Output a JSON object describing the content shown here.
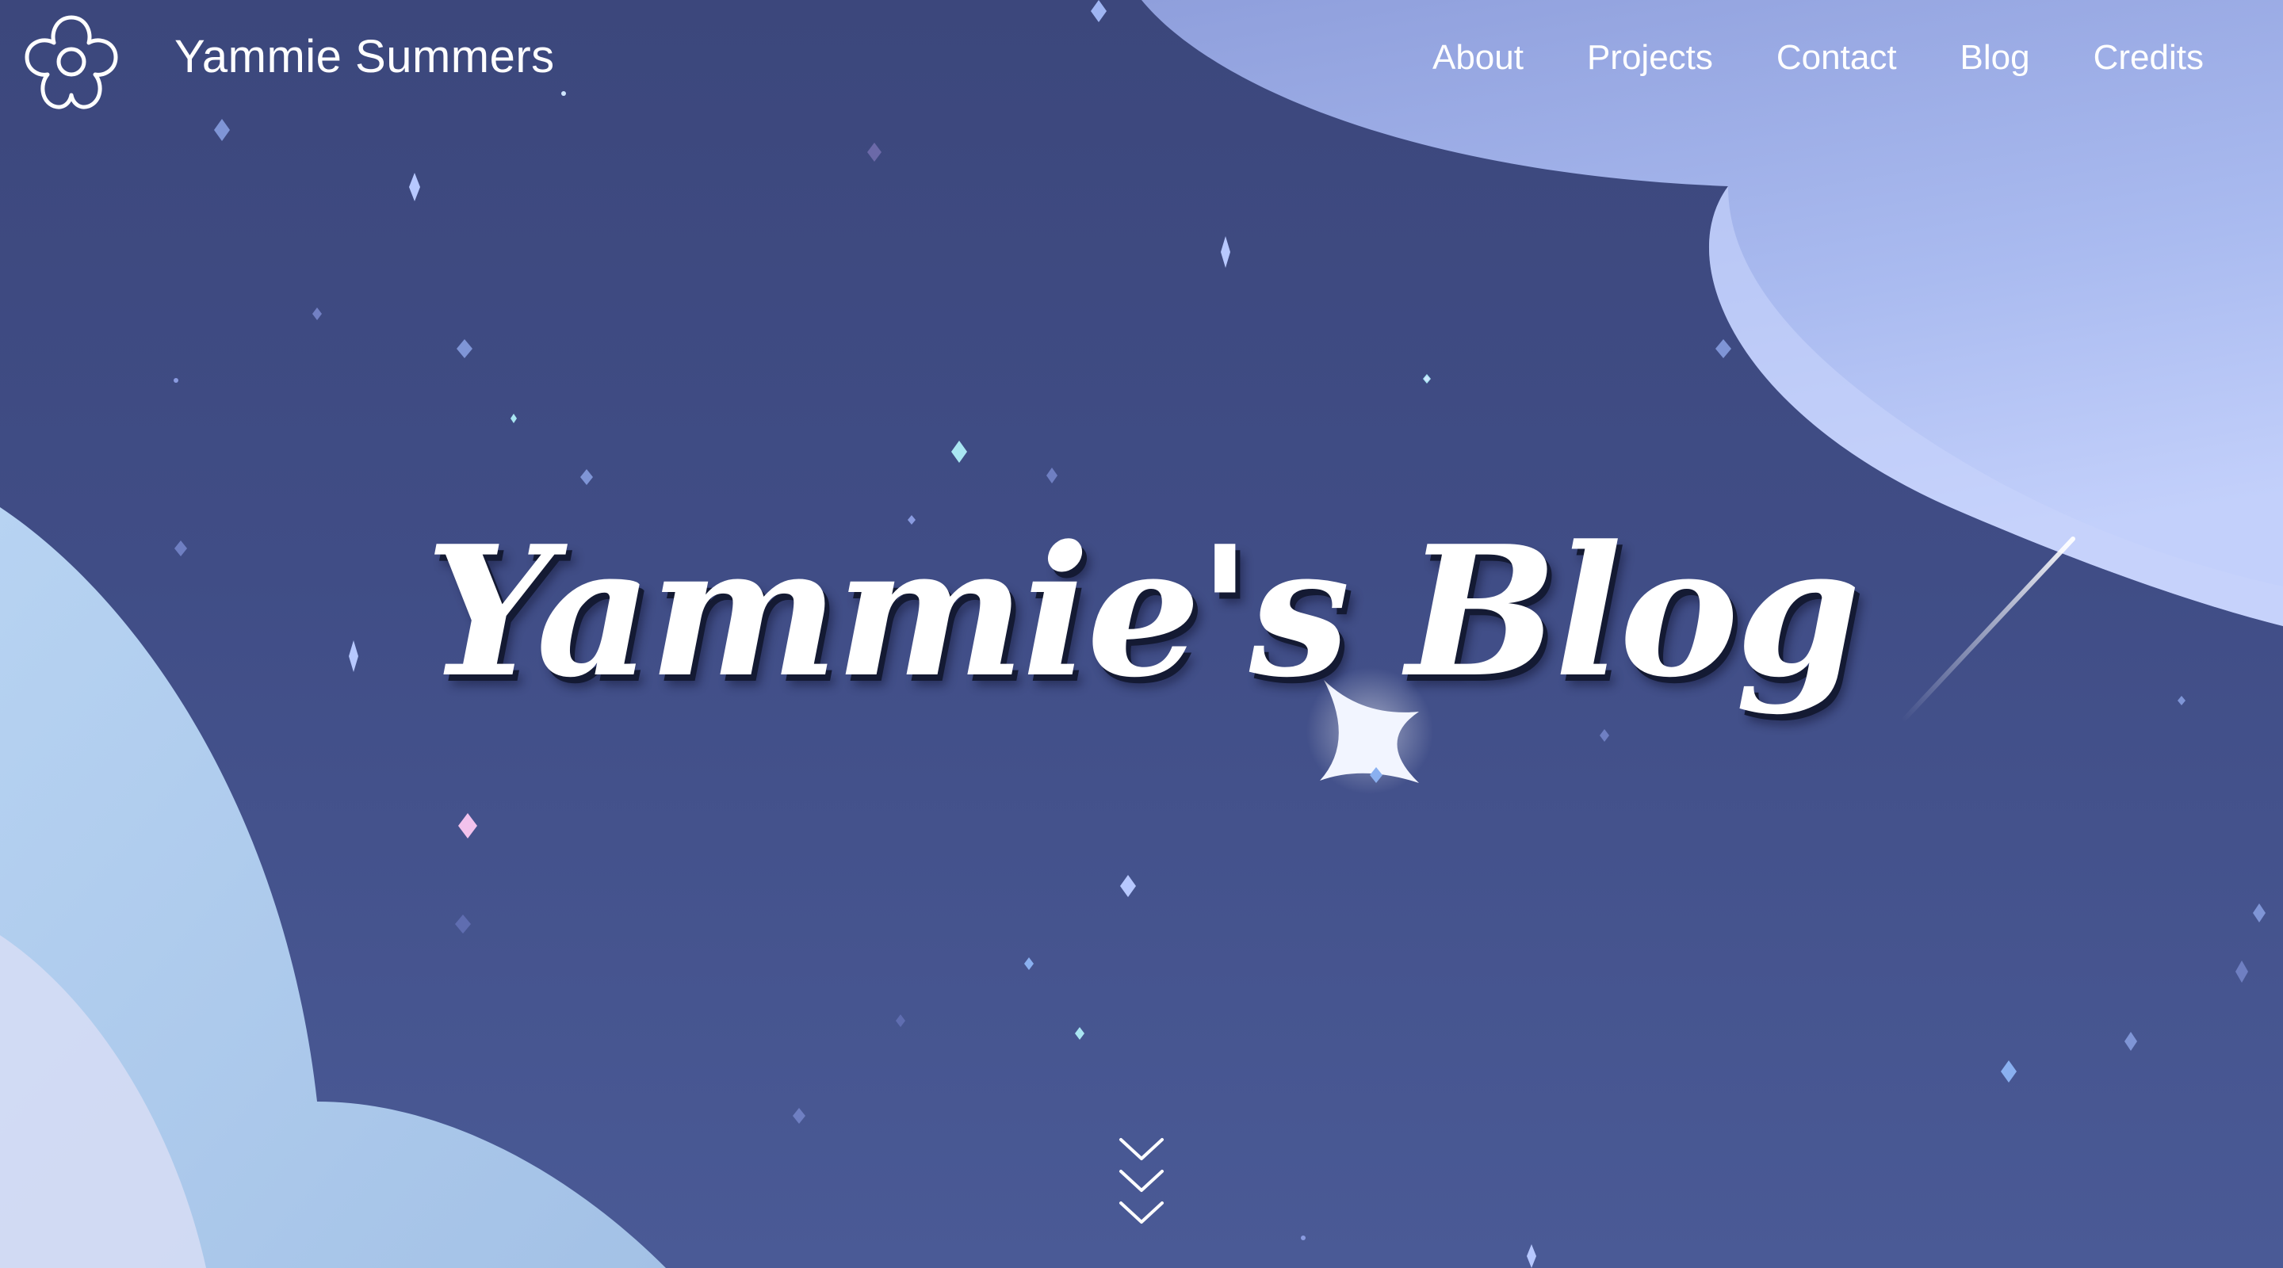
{
  "site": {
    "name": "Yammie Summers",
    "logo_icon": "flower-icon"
  },
  "nav": {
    "items": [
      {
        "label": "About"
      },
      {
        "label": "Projects"
      },
      {
        "label": "Contact"
      },
      {
        "label": "Blog"
      },
      {
        "label": "Credits"
      }
    ]
  },
  "hero": {
    "title": "Yammie's Blog",
    "scroll_icon": "triple-chevron-down-icon",
    "colors": {
      "sky": "#3d4a80",
      "cloud_light": "#b8c6f5",
      "cloud_blue": "#a9c6ea",
      "text": "#ffffff"
    }
  }
}
